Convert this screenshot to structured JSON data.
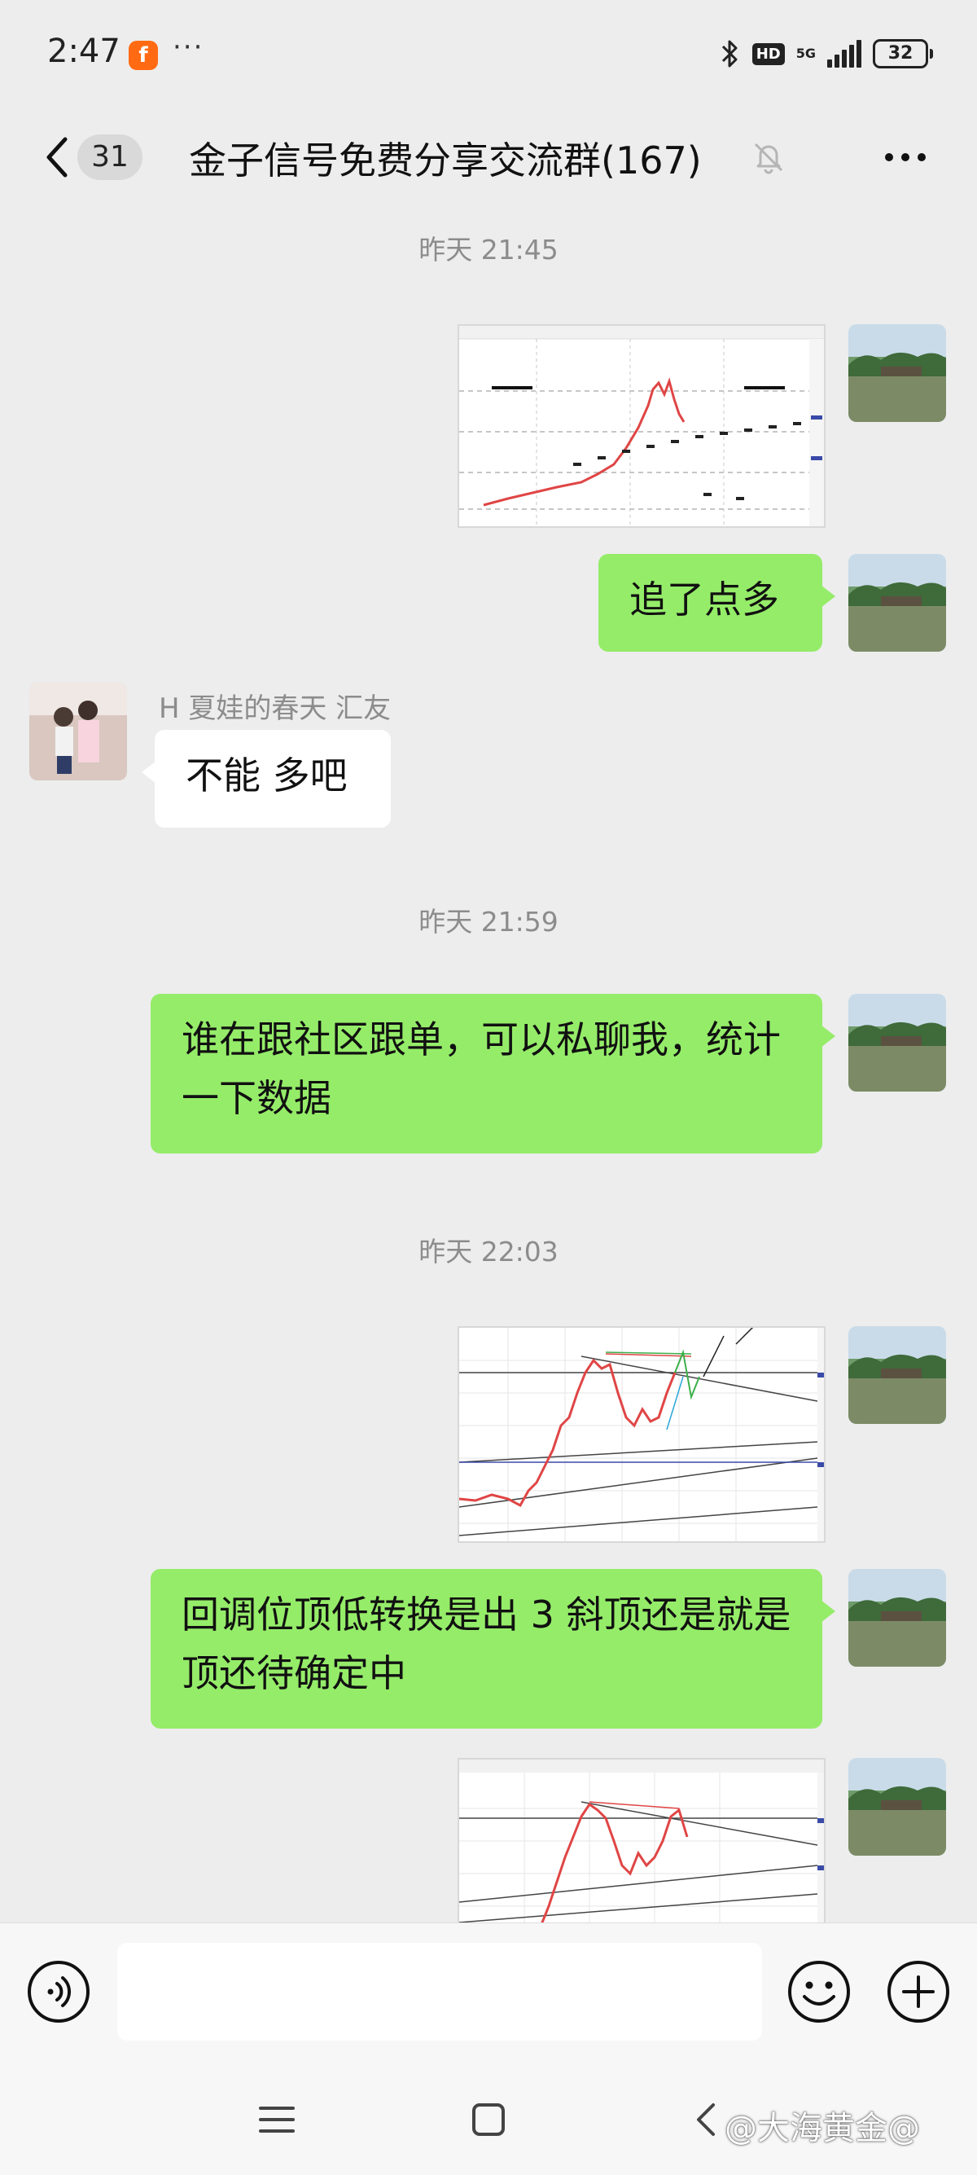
{
  "status_bar": {
    "time": "2:47",
    "app_icon_letter": "f",
    "dots": "···",
    "hd_label": "HD",
    "network_label": "5G",
    "battery": "32"
  },
  "header": {
    "back_count": "31",
    "title": "金子信号免费分享交流群(167)"
  },
  "messages": {
    "ts1": "昨天 21:45",
    "out_msg1": "追了点多",
    "in_sender": "H 夏娃的春天 汇友",
    "in_msg1": "不能 多吧",
    "ts2": "昨天 21:59",
    "out_msg2": "谁在跟社区跟单，可以私聊我，统计一下数据",
    "ts3": "昨天 22:03",
    "out_msg3": "回调位顶低转换是出 3 斜顶还是就是顶还待确定中"
  },
  "input_bar": {
    "placeholder": ""
  },
  "watermark": "@大海黄金@",
  "colors": {
    "bubble_out": "#95ec69",
    "bubble_in": "#ffffff",
    "background": "#ededed",
    "candle_up": "#e04545",
    "candle_down": "#222222"
  }
}
